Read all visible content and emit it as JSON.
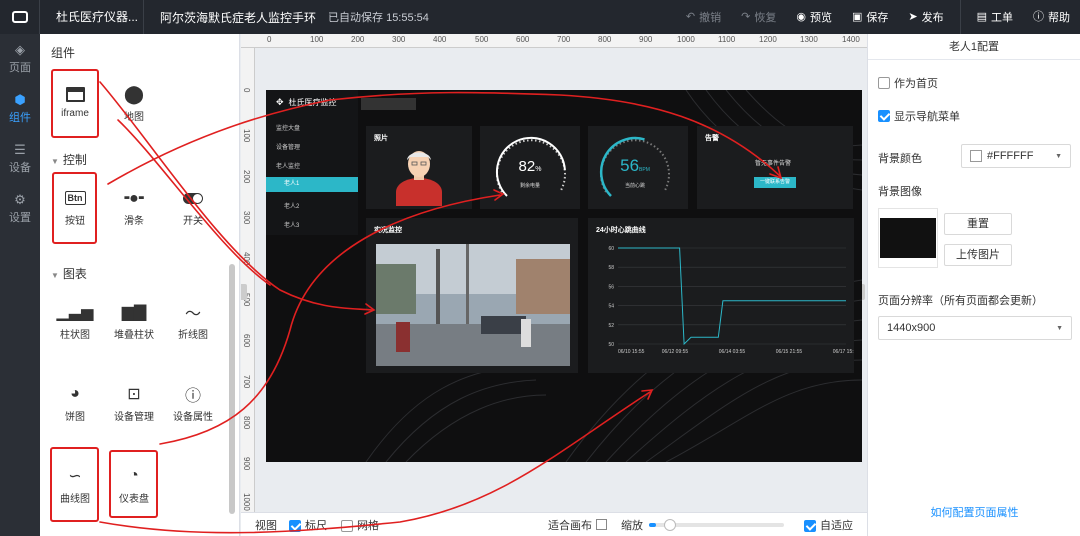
{
  "topbar": {
    "app_name": "杜氏医疗仪器...",
    "page_name": "阿尔茨海默氏症老人监控手环",
    "save_status": "已自动保存 15:55:54",
    "actions": [
      {
        "label": "撤销",
        "icon": "undo-icon",
        "enabled": false
      },
      {
        "label": "恢复",
        "icon": "redo-icon",
        "enabled": false
      },
      {
        "label": "预览",
        "icon": "eye-icon",
        "enabled": true
      },
      {
        "label": "保存",
        "icon": "save-icon",
        "enabled": true
      },
      {
        "label": "发布",
        "icon": "send-icon",
        "enabled": true
      },
      {
        "label": "工单",
        "icon": "ticket-icon",
        "enabled": true
      },
      {
        "label": "帮助",
        "icon": "help-icon",
        "enabled": true
      }
    ]
  },
  "leftnav": {
    "items": [
      {
        "label": "页面",
        "icon": "layers-icon"
      },
      {
        "label": "组件",
        "icon": "cube-icon",
        "active": true
      },
      {
        "label": "设备",
        "icon": "server-icon"
      },
      {
        "label": "设置",
        "icon": "gear-icon"
      }
    ]
  },
  "panel": {
    "title": "组件",
    "section_control": "控制",
    "section_chart": "图表",
    "components": {
      "iframe": "iframe",
      "map": "地图",
      "button": "按钮",
      "button_icon_text": "Btn",
      "slider": "滑条",
      "switch": "开关",
      "bar": "柱状图",
      "stacked_bar": "堆叠柱状",
      "line": "折线图",
      "pie": "饼图",
      "device_mgmt": "设备管理",
      "device_attr": "设备属性",
      "curve": "曲线图",
      "gauge": "仪表盘"
    }
  },
  "ruler": {
    "h_ticks": [
      "0",
      "100",
      "200",
      "300",
      "400",
      "500",
      "600",
      "700",
      "800",
      "900",
      "1000",
      "1100",
      "1200",
      "1300",
      "1400"
    ],
    "v_ticks": [
      "0",
      "100",
      "200",
      "300",
      "400",
      "500",
      "600",
      "700",
      "800",
      "900",
      "1000"
    ]
  },
  "artboard": {
    "logo_text": "杜氏医疗监控",
    "menu": [
      "监控大盘",
      "设备管理",
      "老人监控",
      "老人1",
      "老人2",
      "老人3"
    ],
    "photo_title": "照片",
    "gauge1": {
      "value": "82",
      "unit": "%",
      "label": "剩余电量",
      "fraction": 0.82
    },
    "gauge2": {
      "value": "56",
      "unit": "BPM",
      "label": "当前心跳",
      "fraction": 0.56
    },
    "alarm_title": "告警",
    "alarm_text": "暂无事件告警",
    "alarm_button": "一键联系告警",
    "live_title": "实况监控",
    "hr_title": "24小时心跳曲线",
    "hr_chart": {
      "y_ticks": [
        "60",
        "58",
        "56",
        "54",
        "52",
        "50"
      ],
      "x_ticks": [
        "06/10 15:55",
        "06/12 09:55",
        "06/14 03:55",
        "06/15 21:55",
        "06/17 15:55"
      ]
    }
  },
  "bottombar": {
    "view_label": "视图",
    "ruler_label": "标尺",
    "grid_label": "网格",
    "fit_label": "适合画布",
    "zoom_label": "缩放",
    "zoom_level": 0.05,
    "adaptive_label": "自适应"
  },
  "rightpanel": {
    "title": "老人1配置",
    "home_label": "作为首页",
    "nav_label": "显示导航菜单",
    "bg_color_label": "背景颜色",
    "bg_color_value": "#FFFFFF",
    "bg_image_label": "背景图像",
    "reset_label": "重置",
    "upload_label": "上传图片",
    "resolution_label": "页面分辨率（所有页面都会更新）",
    "resolution_value": "1440x900",
    "help_link": "如何配置页面属性"
  }
}
